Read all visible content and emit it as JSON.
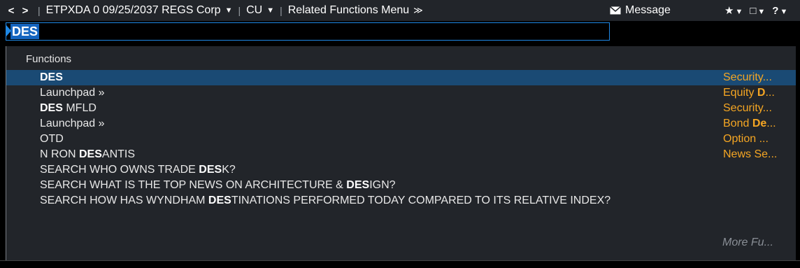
{
  "toolbar": {
    "back": "<",
    "forward": ">",
    "security": "ETPXDA 0 09/25/2037 REGS Corp",
    "currency": "CU",
    "related": "Related Functions Menu",
    "related_icon": "≫",
    "message": "Message",
    "icons": [
      "★",
      "□",
      "?"
    ]
  },
  "command": {
    "value": "DES"
  },
  "panel": {
    "header": "Functions",
    "rows": [
      {
        "pre": "",
        "hl": "DES",
        "post": "",
        "desc_pre": "Security",
        "desc_hl": "",
        "desc_post": "...",
        "selected": true
      },
      {
        "pre": "Launchpad »",
        "hl": "",
        "post": "",
        "desc_pre": "Equity ",
        "desc_hl": "D",
        "desc_post": "...",
        "selected": false
      },
      {
        "pre": "",
        "hl": "DES",
        "post": " MFLD",
        "desc_pre": "Security",
        "desc_hl": "",
        "desc_post": "...",
        "selected": false
      },
      {
        "pre": "Launchpad »",
        "hl": "",
        "post": "",
        "desc_pre": "Bond ",
        "desc_hl": "De",
        "desc_post": "...",
        "selected": false
      },
      {
        "pre": "OTD",
        "hl": "",
        "post": "",
        "desc_pre": "Option ",
        "desc_hl": "",
        "desc_post": "...",
        "selected": false
      },
      {
        "pre": "N RON ",
        "hl": "DES",
        "post": "ANTIS",
        "desc_pre": "News Se",
        "desc_hl": "",
        "desc_post": "...",
        "selected": false
      },
      {
        "pre": "SEARCH WHO OWNS TRADE ",
        "hl": "DES",
        "post": "K?",
        "desc_pre": "",
        "desc_hl": "",
        "desc_post": "",
        "selected": false
      },
      {
        "pre": "SEARCH WHAT IS THE TOP NEWS ON ARCHITECTURE & ",
        "hl": "DES",
        "post": "IGN?",
        "desc_pre": "",
        "desc_hl": "",
        "desc_post": "",
        "selected": false
      },
      {
        "pre": "SEARCH HOW HAS WYNDHAM ",
        "hl": "DES",
        "post": "TINATIONS PERFORMED TODAY COMPARED TO ITS RELATIVE INDEX?",
        "desc_pre": "",
        "desc_hl": "",
        "desc_post": "",
        "selected": false
      }
    ],
    "more": "More Fu..."
  },
  "colors": {
    "accent_blue": "#1e88e5",
    "selected_row": "#1a4a74",
    "description_orange": "#f5a623",
    "panel_bg": "#22252a"
  }
}
